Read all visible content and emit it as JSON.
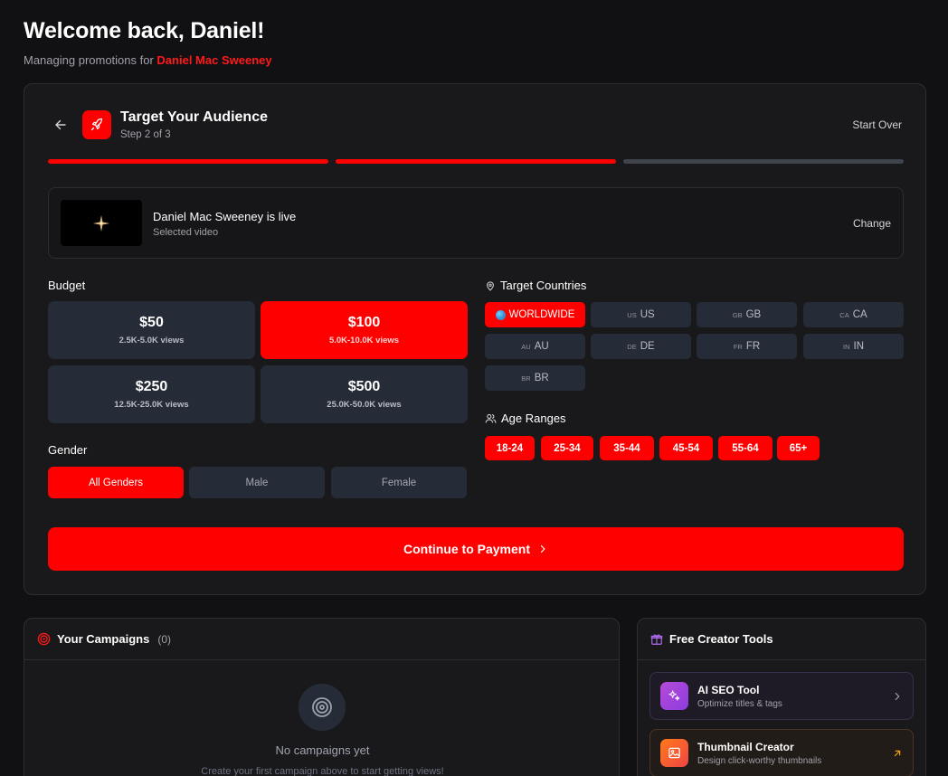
{
  "header": {
    "welcome": "Welcome back, Daniel!",
    "managing_prefix": "Managing promotions for ",
    "creator_name": "Daniel Mac Sweeney"
  },
  "wizard": {
    "title": "Target Your Audience",
    "step": "Step 2 of 3",
    "start_over": "Start Over",
    "progress_steps_completed": 2,
    "progress_steps_total": 3
  },
  "video": {
    "title": "Daniel Mac Sweeney is live",
    "subtitle": "Selected video",
    "change_label": "Change"
  },
  "budget": {
    "label": "Budget",
    "options": [
      {
        "amount": "$50",
        "views": "2.5K-5.0K views",
        "selected": false
      },
      {
        "amount": "$100",
        "views": "5.0K-10.0K views",
        "selected": true
      },
      {
        "amount": "$250",
        "views": "12.5K-25.0K views",
        "selected": false
      },
      {
        "amount": "$500",
        "views": "25.0K-50.0K views",
        "selected": false
      }
    ]
  },
  "gender": {
    "label": "Gender",
    "options": [
      "All Genders",
      "Male",
      "Female"
    ],
    "selected": "All Genders"
  },
  "countries": {
    "label": "Target Countries",
    "options": [
      {
        "code": "",
        "name": "WORLDWIDE",
        "selected": true
      },
      {
        "code": "US",
        "name": "US",
        "selected": false
      },
      {
        "code": "GB",
        "name": "GB",
        "selected": false
      },
      {
        "code": "CA",
        "name": "CA",
        "selected": false
      },
      {
        "code": "AU",
        "name": "AU",
        "selected": false
      },
      {
        "code": "DE",
        "name": "DE",
        "selected": false
      },
      {
        "code": "FR",
        "name": "FR",
        "selected": false
      },
      {
        "code": "IN",
        "name": "IN",
        "selected": false
      },
      {
        "code": "BR",
        "name": "BR",
        "selected": false
      }
    ]
  },
  "ages": {
    "label": "Age Ranges",
    "options": [
      "18-24",
      "25-34",
      "35-44",
      "45-54",
      "55-64",
      "65+"
    ]
  },
  "continue_label": "Continue to Payment",
  "campaigns": {
    "title": "Your Campaigns",
    "count": "(0)",
    "empty_title": "No campaigns yet",
    "empty_sub": "Create your first campaign above to start getting views!"
  },
  "tools": {
    "title": "Free Creator Tools",
    "items": [
      {
        "name": "AI SEO Tool",
        "desc": "Optimize titles & tags"
      },
      {
        "name": "Thumbnail Creator",
        "desc": "Design click-worthy thumbnails"
      }
    ]
  },
  "colors": {
    "accent": "#ff0000",
    "background": "#111113",
    "card": "#19191b",
    "chip": "#262c37"
  },
  "icons": [
    "arrow-left-icon",
    "rocket-icon",
    "map-pin-icon",
    "users-icon",
    "chevron-right-icon",
    "target-icon",
    "gift-icon",
    "sparkles-icon",
    "image-icon",
    "arrow-up-right-icon"
  ]
}
